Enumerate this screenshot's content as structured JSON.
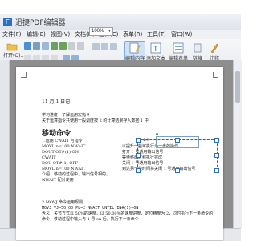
{
  "app": {
    "title": "迅捷PDF编辑器",
    "logo_letter": "F"
  },
  "menu": {
    "items": [
      "文件(F)",
      "编辑(E)",
      "视图(V)",
      "文档(D)",
      "注释(C)",
      "表单(R)",
      "工具(T)",
      "窗口(W)"
    ]
  },
  "toolbar": {
    "open_label": "打开(O)...",
    "zoom_value": "100%",
    "edit_content_label": "编辑内容",
    "add_text_label": "添加文本",
    "edit_form_label": "编辑表单",
    "link_label": "链接",
    "annotate_label": "注释",
    "accent_color": "#2f6fbf",
    "active_tool_color": "#cfe3f7"
  },
  "page": {
    "heading": "11 月 1 日记",
    "intro_lines": [
      "学习进度：了解运用宏指令",
      "关于运算指令共使用一般调度按 2 的计算结果存入数据 1 中"
    ],
    "section_title": "移动命令",
    "code_lines": [
      "1.运用 CWAIT 与指令",
      "MOVL  n=100 NWAIT",
      "DOUT OT#(1) ON",
      "CWAIT",
      "DOU OT#(1) OFF",
      "MOVL  n=100 NWAIT",
      "介绍：移动的过程中，输出信号相的。",
      "NWAIT 配对使用"
    ],
    "side_note_lines": [
      "1.9",
      "以提升一些可执行为一步的操作。",
      "打开 1 号通用输出信号",
      "等待移动过程执行完成",
      "关闭 1 号通用输出信号",
      "到达另一些时间将关闭 1 号通用输出信号"
    ],
    "bottom_lines": [
      "2.MOVJ 命令运用规则",
      "MOVJ    VJ=50.00    PL=2    NWAIT    UNTIL    IN#(1)=ON",
      "含义：关节方式以 50%的速度，以 50.00%的速度进度，定位精度为 2，同时执行下一条命令的",
      "命令，移动过程中输入与 1 号 on 后，执行下一条命令"
    ]
  }
}
